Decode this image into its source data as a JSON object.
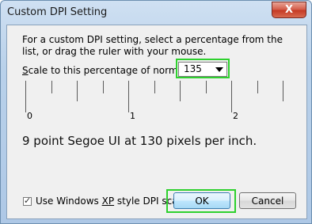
{
  "window": {
    "title": "Custom DPI Setting",
    "close_glyph": "X"
  },
  "description": "For a custom DPI setting, select a percentage from the list, or drag the ruler with your mouse.",
  "scale": {
    "label_underlined": "S",
    "label_rest": "cale to this percentage of normal size:",
    "selected_value": "135"
  },
  "ruler": {
    "labels": [
      "0",
      "1",
      "2"
    ]
  },
  "sample_text": "9 point Segoe UI at 130 pixels per inch.",
  "checkbox": {
    "checked": true,
    "check_glyph": "✓",
    "label_prefix": "Use Windows ",
    "label_underlined": "XP",
    "label_suffix": " style DPI scaling"
  },
  "buttons": {
    "ok": "OK",
    "cancel": "Cancel"
  },
  "highlight_color": "#2ed12e"
}
